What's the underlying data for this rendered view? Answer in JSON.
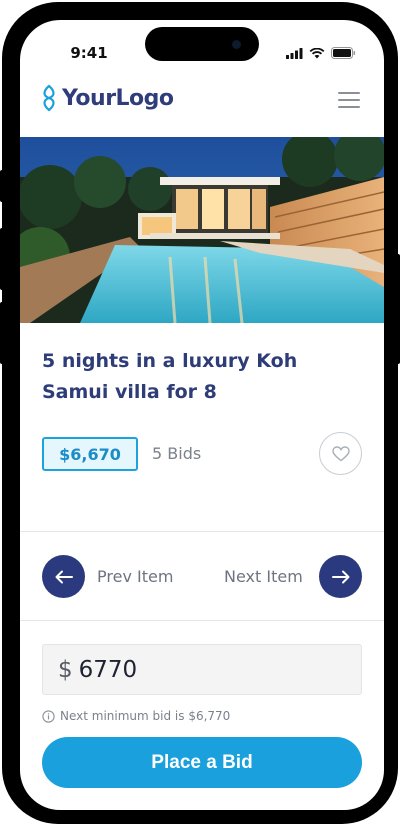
{
  "status_bar": {
    "time": "9:41"
  },
  "header": {
    "logo_text": "YourLogo"
  },
  "listing": {
    "title": "5 nights in a luxury Koh Samui villa for 8",
    "current_bid": "$6,670",
    "bids_count": "5 Bids"
  },
  "navigation": {
    "prev_label": "Prev Item",
    "next_label": "Next Item"
  },
  "bid_form": {
    "currency_symbol": "$",
    "amount": "6770",
    "hint": "Next minimum bid is $6,770",
    "submit_label": "Place a Bid"
  },
  "colors": {
    "brand_navy": "#2e3d78",
    "accent_blue": "#1aa0dc"
  },
  "icons": [
    "signal-icon",
    "wifi-icon",
    "battery-icon",
    "logo-mark-icon",
    "hamburger-menu-icon",
    "heart-icon",
    "arrow-left-icon",
    "arrow-right-icon",
    "info-icon"
  ]
}
